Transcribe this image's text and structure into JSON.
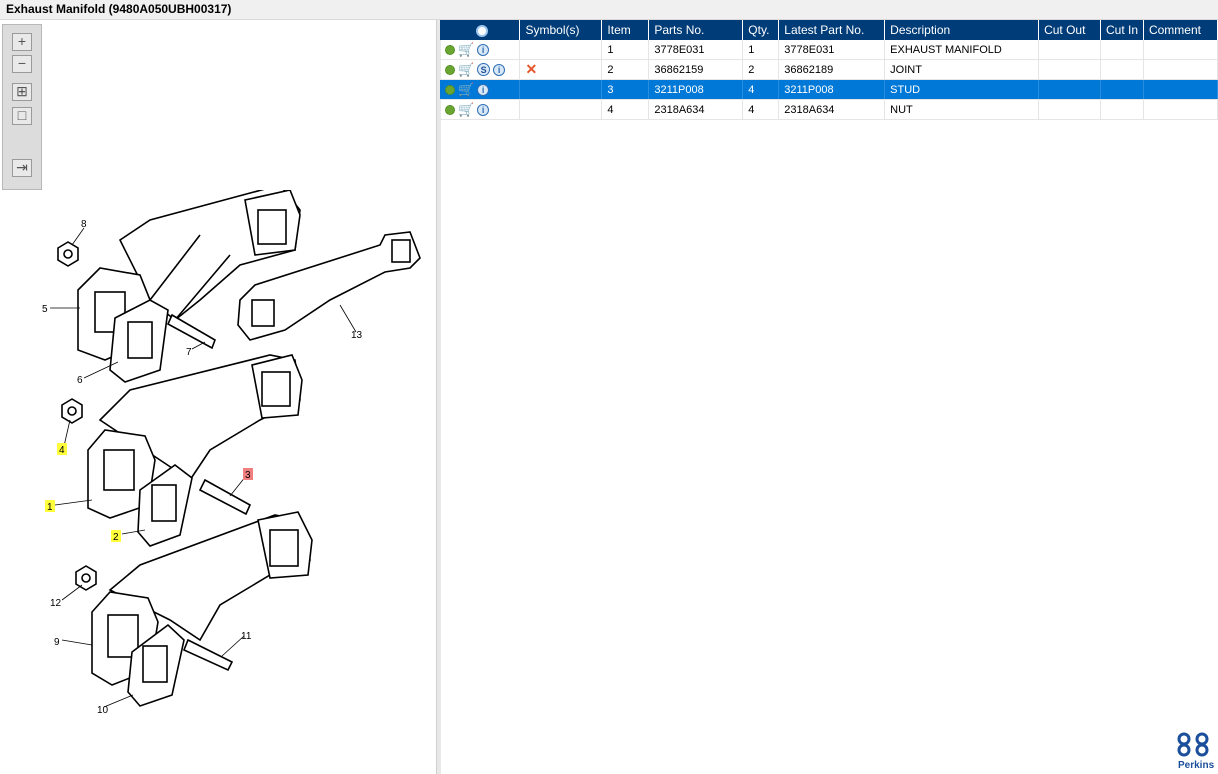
{
  "window": {
    "title": "Exhaust Manifold (9480A050UBH00317)"
  },
  "toolbar": {
    "zoom_in": "+",
    "zoom_out": "−",
    "fit_all": "⊞",
    "fit_page": "□",
    "export": "⇥"
  },
  "diagram": {
    "callouts": [
      "8",
      "5",
      "6",
      "7",
      "13",
      "4",
      "1",
      "2",
      "3",
      "12",
      "9",
      "10",
      "11"
    ]
  },
  "table": {
    "columns": [
      "Symbol(s)",
      "Item",
      "Parts No.",
      "Qty.",
      "Latest Part No.",
      "Description",
      "Cut Out",
      "Cut In",
      "Comment"
    ],
    "rows": [
      {
        "item": "1",
        "parts_no": "3778E031",
        "qty": "1",
        "latest": "3778E031",
        "description": "EXHAUST MANIFOLD",
        "cut_out": "",
        "cut_in": "",
        "comment": ""
      },
      {
        "item": "2",
        "parts_no": "36862159",
        "qty": "2",
        "latest": "36862189",
        "description": "JOINT",
        "cut_out": "",
        "cut_in": "",
        "comment": ""
      },
      {
        "item": "3",
        "parts_no": "3211P008",
        "qty": "4",
        "latest": "3211P008",
        "description": "STUD",
        "cut_out": "",
        "cut_in": "",
        "comment": ""
      },
      {
        "item": "4",
        "parts_no": "2318A634",
        "qty": "4",
        "latest": "2318A634",
        "description": "NUT",
        "cut_out": "",
        "cut_in": "",
        "comment": ""
      }
    ],
    "selected_row": "3"
  },
  "brand": {
    "name": "Perkins"
  },
  "colors": {
    "header": "#003c78",
    "selection": "#0078d7",
    "highlight_yellow": "#ffff3b",
    "highlight_red": "#f08080"
  }
}
